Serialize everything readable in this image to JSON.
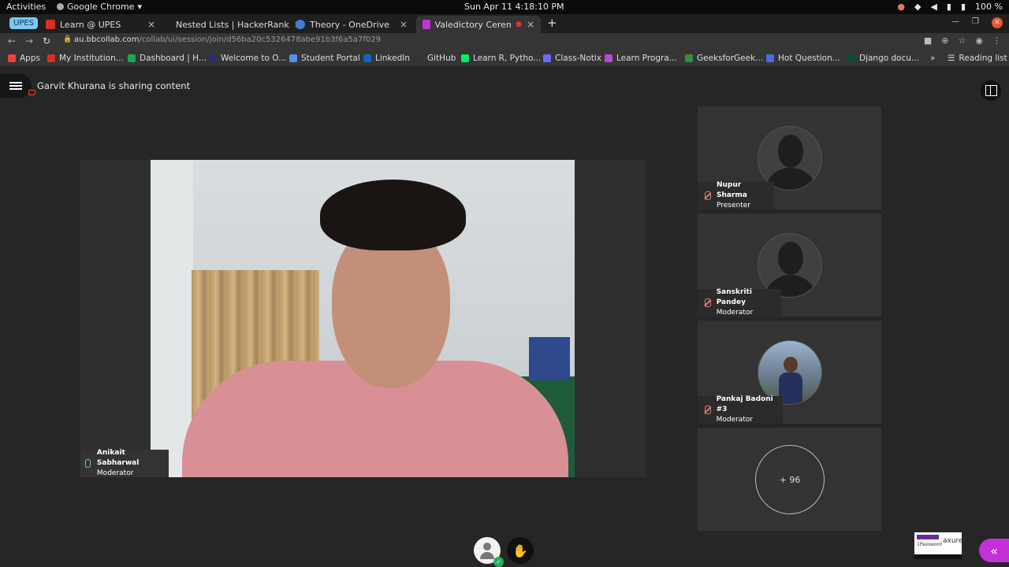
{
  "system": {
    "activities": "Activities",
    "app_name": "Google Chrome",
    "datetime": "Sun Apr 11   4:18:10 PM",
    "battery": "100 %"
  },
  "tabs": [
    {
      "label": "Learn @ UPES",
      "color": "#d93025"
    },
    {
      "label": "Nested Lists | HackerRank",
      "color": "#1ba94c"
    },
    {
      "label": "Theory - OneDrive",
      "color": "#3f7fd6"
    },
    {
      "label": "Valedictory Ceremony",
      "color": "#c430d9"
    }
  ],
  "tab_badge": "UPES",
  "address": {
    "host": "au.bbcollab.com",
    "path": "/collab/ui/session/join/d56ba20c5326478abe91b3f6a5a7f029"
  },
  "bookmarks": [
    {
      "label": "Apps",
      "color": "#e8453c"
    },
    {
      "label": "My Institution...",
      "color": "#d93025"
    },
    {
      "label": "Dashboard | H...",
      "color": "#1ba94c"
    },
    {
      "label": "Welcome to O...",
      "color": "#2b2b6b"
    },
    {
      "label": "Student Portal",
      "color": "#5a8dee"
    },
    {
      "label": "LinkedIn",
      "color": "#0a66c2"
    },
    {
      "label": "GitHub",
      "color": "#333333"
    },
    {
      "label": "Learn R, Pytho...",
      "color": "#03ef62"
    },
    {
      "label": "Class-Notix",
      "color": "#6a6aff"
    },
    {
      "label": "Learn Progra...",
      "color": "#b44ad6"
    },
    {
      "label": "GeeksforGeek...",
      "color": "#2f8d46"
    },
    {
      "label": "Hot Question...",
      "color": "#4a6ee0"
    },
    {
      "label": "Django docu...",
      "color": "#0c4b33"
    }
  ],
  "bookmarks_more": "»",
  "reading_list": "Reading list",
  "session": {
    "sharing_text": "Garvit Khurana is sharing content",
    "main_video": {
      "name": "Anikait Sabharwal",
      "role": "Moderator"
    },
    "participants": [
      {
        "name": "Nupur Sharma",
        "role": "Presenter"
      },
      {
        "name": "Sanskriti Pandey",
        "role": "Moderator"
      },
      {
        "name": "Pankaj Badoni #3",
        "role": "Moderator"
      }
    ],
    "more_count": "+ 96"
  },
  "ad": {
    "line1": "1Password",
    "line2": "axure"
  }
}
